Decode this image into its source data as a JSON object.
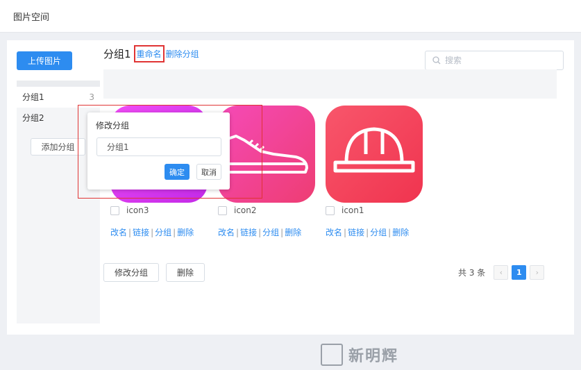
{
  "header": {
    "title": "图片空间"
  },
  "toolbar": {
    "upload_label": "上传图片"
  },
  "search": {
    "placeholder": "搜索",
    "icon": "search-icon"
  },
  "sidebar": {
    "groups": [
      {
        "label": "分组1",
        "count": "3"
      },
      {
        "label": "分组2",
        "count": ""
      }
    ],
    "add_group_label": "添加分组"
  },
  "content": {
    "group_name": "分组1",
    "rename_label": "重命名",
    "delete_group_label": "删除分组"
  },
  "images": [
    {
      "name": "icon3",
      "icon": "bowl-icon",
      "color": "#e23df0"
    },
    {
      "name": "icon2",
      "icon": "shoe-icon",
      "color": "#f0478f"
    },
    {
      "name": "icon1",
      "icon": "helmet-icon",
      "color": "#f53f5b"
    }
  ],
  "card_actions": {
    "rename": "改名",
    "link": "链接",
    "group": "分组",
    "delete": "删除",
    "separator": "|"
  },
  "footer": {
    "edit_group_label": "修改分组",
    "delete_label": "删除",
    "total_text": "共 3 条",
    "current_page": "1",
    "prev_icon": "chevron-left-icon",
    "next_icon": "chevron-right-icon"
  },
  "popover": {
    "title": "修改分组",
    "input_value": "分组1",
    "ok_label": "确定",
    "cancel_label": "取消"
  },
  "watermark": {
    "text": "新明辉"
  },
  "colors": {
    "primary": "#2d8cf0",
    "highlight": "#e03434"
  }
}
